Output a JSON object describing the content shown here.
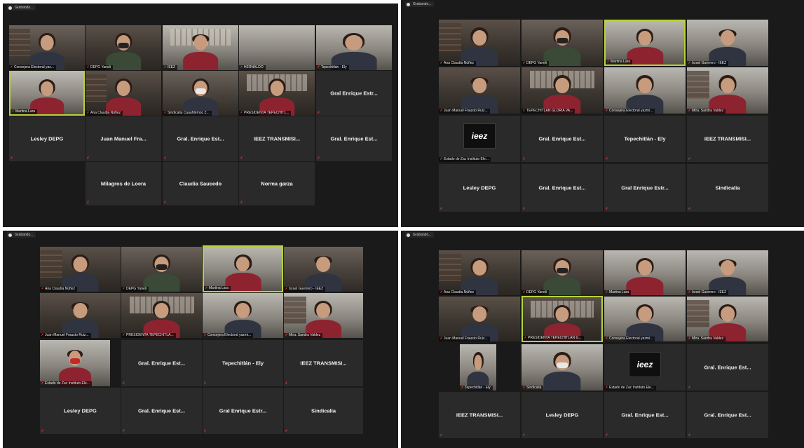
{
  "recording_label": "Grabando...",
  "panels": [
    {
      "tiles": [
        {
          "label": "Consejera Electoral yaz...",
          "name": ""
        },
        {
          "label": "DEPG Yaneli",
          "name": ""
        },
        {
          "label": "IEEZ",
          "name": ""
        },
        {
          "label": "HERNALDO",
          "name": ""
        },
        {
          "label": "Tepechitlán - Ely",
          "name": ""
        },
        {
          "label": "Martina Lara",
          "name": ""
        },
        {
          "label": "Ana Claudia Núñez",
          "name": ""
        },
        {
          "label": "Sindicalia Cuauhtémoc Z...",
          "name": ""
        },
        {
          "label": "PRESIDENTA TEPECHITL...",
          "name": ""
        },
        {
          "label": "",
          "name": "Gral Enrique Estr..."
        },
        {
          "label": "",
          "name": "Lesley DEPG"
        },
        {
          "label": "",
          "name": "Juan Manuel Fra..."
        },
        {
          "label": "",
          "name": "Gral. Enrique Est..."
        },
        {
          "label": "",
          "name": "IEEZ TRANSMISI..."
        },
        {
          "label": "",
          "name": "Gral. Enrique Est..."
        },
        {
          "label": "",
          "name": "Milagros de Loera"
        },
        {
          "label": "",
          "name": "Claudia Saucedo"
        },
        {
          "label": "",
          "name": "Norma garza"
        }
      ]
    },
    {
      "tiles": [
        {
          "label": "Ana Claudia Núñez",
          "name": ""
        },
        {
          "label": "DEPG Yaneli",
          "name": ""
        },
        {
          "label": "Martina Lara",
          "name": ""
        },
        {
          "label": "Israel Guerrero - IEEZ",
          "name": ""
        },
        {
          "label": "Juan Manuel Frausto Ruiz...",
          "name": ""
        },
        {
          "label": "TEPECHITLAN GLORIA VA...",
          "name": ""
        },
        {
          "label": "Consejera Electoral yazmi...",
          "name": ""
        },
        {
          "label": "Mtra. Sandra Valdez",
          "name": ""
        },
        {
          "label": "Estado de Zac Instituto Ele...",
          "name": ""
        },
        {
          "label": "",
          "name": "Gral. Enrique Est..."
        },
        {
          "label": "",
          "name": "Tepechitlán - Ely"
        },
        {
          "label": "",
          "name": "IEEZ TRANSMISI..."
        },
        {
          "label": "",
          "name": "Lesley DEPG"
        },
        {
          "label": "",
          "name": "Gral. Enrique Est..."
        },
        {
          "label": "",
          "name": "Gral Enrique Estr..."
        },
        {
          "label": "",
          "name": "Sindicalia"
        }
      ]
    },
    {
      "tiles": [
        {
          "label": "Ana Claudia Núñez",
          "name": ""
        },
        {
          "label": "DEPG Yaneli",
          "name": ""
        },
        {
          "label": "Martina Lara",
          "name": ""
        },
        {
          "label": "Israel Guerrero - IEEZ",
          "name": ""
        },
        {
          "label": "Juan Manuel Frausto Ruiz...",
          "name": ""
        },
        {
          "label": "PRESIDENTA TEPECHITLA...",
          "name": ""
        },
        {
          "label": "Consejera Electoral yazmi...",
          "name": ""
        },
        {
          "label": "Mtra. Sandra Valdez",
          "name": ""
        },
        {
          "label": "Estado de Zac Instituto Ele...",
          "name": ""
        },
        {
          "label": "",
          "name": "Gral. Enrique Est..."
        },
        {
          "label": "",
          "name": "Tepechitlán - Ely"
        },
        {
          "label": "",
          "name": "IEEZ TRANSMISI..."
        },
        {
          "label": "",
          "name": "Lesley DEPG"
        },
        {
          "label": "",
          "name": "Gral. Enrique Est..."
        },
        {
          "label": "",
          "name": "Gral Enrique Estr..."
        },
        {
          "label": "",
          "name": "Sindicalia"
        }
      ]
    },
    {
      "tiles": [
        {
          "label": "Ana Claudia Núñez",
          "name": ""
        },
        {
          "label": "DEPG Yaneli",
          "name": ""
        },
        {
          "label": "Martina Lara",
          "name": ""
        },
        {
          "label": "Israel Guerrero - IEEZ",
          "name": ""
        },
        {
          "label": "Juan Manuel Frausto Ruiz...",
          "name": ""
        },
        {
          "label": "PRESIDENTA TEPECHITLAN G...",
          "name": ""
        },
        {
          "label": "Consejera Electoral yazmi...",
          "name": ""
        },
        {
          "label": "Mtra. Sandra Valdez",
          "name": ""
        },
        {
          "label": "Tepechitlán - Ely",
          "name": ""
        },
        {
          "label": "Sindicalia",
          "name": ""
        },
        {
          "label": "Estado de Zac Instituto Ele...",
          "name": ""
        },
        {
          "label": "",
          "name": "Gral. Enrique Est..."
        },
        {
          "label": "",
          "name": "IEEZ TRANSMISI..."
        },
        {
          "label": "",
          "name": "Lesley DEPG"
        },
        {
          "label": "",
          "name": "Gral. Enrique Est..."
        },
        {
          "label": "",
          "name": "Gral. Enrique Est..."
        }
      ]
    }
  ],
  "logo_text": "ieez"
}
